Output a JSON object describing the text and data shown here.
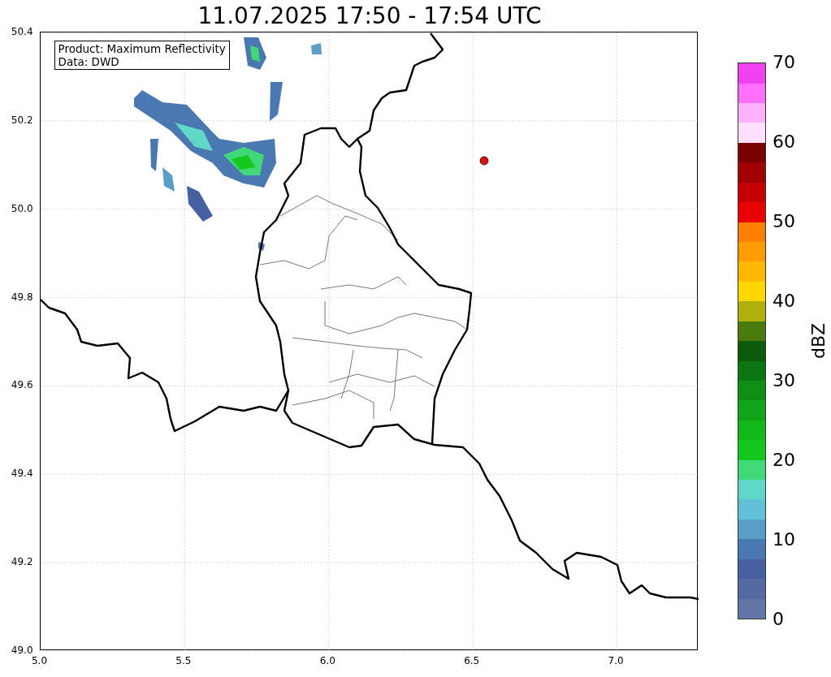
{
  "title": "11.07.2025 17:50 - 17:54 UTC",
  "annotation": {
    "lines": [
      "Product: Maximum Reflectivity",
      "Data: DWD"
    ]
  },
  "y_ticks": [
    "50.4",
    "50.2",
    "50.0",
    "49.8",
    "49.6",
    "49.4",
    "49.2",
    "49.0"
  ],
  "x_ticks": [
    "5.0",
    "5.5",
    "6.0",
    "6.5",
    "7.0"
  ],
  "colorbar": {
    "label": "dBZ",
    "ticks": [
      "70",
      "60",
      "50",
      "40",
      "30",
      "20",
      "10",
      "0"
    ],
    "bins": [
      {
        "color": "#6477a8"
      },
      {
        "color": "#566aa2"
      },
      {
        "color": "#4660a0"
      },
      {
        "color": "#4a78b0"
      },
      {
        "color": "#5a9ec8"
      },
      {
        "color": "#62c0d8"
      },
      {
        "color": "#60d8c8"
      },
      {
        "color": "#40d878"
      },
      {
        "color": "#14c820"
      },
      {
        "color": "#12b81a"
      },
      {
        "color": "#10a418"
      },
      {
        "color": "#0e8e12"
      },
      {
        "color": "#0c7612"
      },
      {
        "color": "#0a5c0c"
      },
      {
        "color": "#4a7a0c"
      },
      {
        "color": "#b0b00a"
      },
      {
        "color": "#ffd800"
      },
      {
        "color": "#ffb800"
      },
      {
        "color": "#ff9c00"
      },
      {
        "color": "#ff8000"
      },
      {
        "color": "#e80000"
      },
      {
        "color": "#c40000"
      },
      {
        "color": "#a00000"
      },
      {
        "color": "#7c0000"
      },
      {
        "color": "#ffe0ff"
      },
      {
        "color": "#ffb0ff"
      },
      {
        "color": "#ff70ff"
      },
      {
        "color": "#f040f0"
      }
    ]
  }
}
